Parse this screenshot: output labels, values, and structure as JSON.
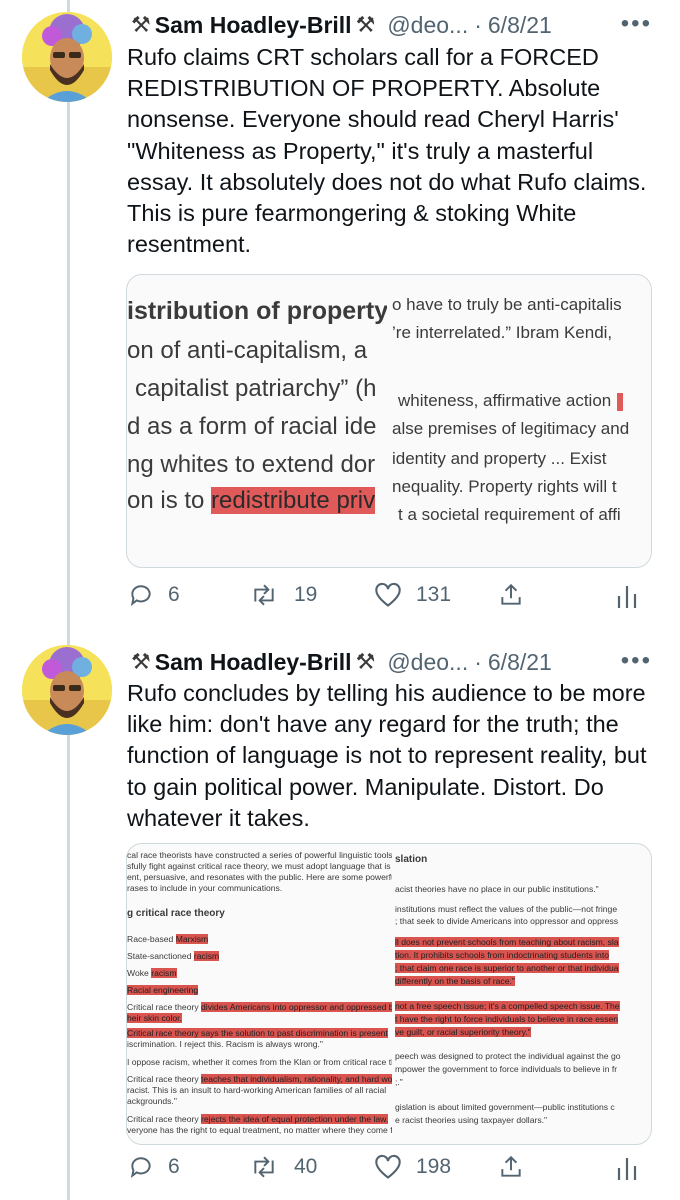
{
  "colors": {
    "thread_line": "#cfd9de",
    "secondary_text": "#536471",
    "highlight": "#e05a5a"
  },
  "tweets": [
    {
      "name": "Sam Hoadley-Brill",
      "emoji": "⚒",
      "handle": "@deo...",
      "dot": "·",
      "date": "6/8/21",
      "more": "•••",
      "text": "Rufo claims CRT scholars call for a FORCED REDISTRIBUTION OF PROPERTY. Absolute nonsense. Everyone should read Cheryl Harris' \"Whiteness as Property,\" it's truly a masterful essay. It absolutely does not do what Rufo claims. This is pure fearmongering & stoking White resentment.",
      "media": {
        "left_lines": [
          "istribution of property",
          "on of anti-capitalism, a",
          "capitalist patriarchy” (h",
          "d as a form of racial ide",
          "ng whites to extend dor",
          "on is to "
        ],
        "left_highlight": "redistribute priv",
        "right_lines": [
          "o have to truly be anti-capitalis",
          "’re interrelated.” Ibram Kendi,",
          "whiteness, affirmative action",
          "alse premises of legitimacy and",
          "identity and property ... Exist",
          "nequality. Property rights will t",
          "t a societal requirement of affi"
        ]
      },
      "actions": {
        "reply_icon": "reply-icon",
        "replies": "6",
        "retweet_icon": "retweet-icon",
        "retweets": "19",
        "like_icon": "like-icon",
        "likes": "131",
        "share_icon": "share-icon",
        "analytics_icon": "analytics-icon"
      }
    },
    {
      "name": "Sam Hoadley-Brill",
      "emoji": "⚒",
      "handle": "@deo...",
      "dot": "·",
      "date": "6/8/21",
      "more": "•••",
      "text": "Rufo concludes by telling his audience to be more like him: don't have any regard for the truth; the function of language is not to represent reality, but to gain political power. Manipulate. Distort. Do whatever it takes.",
      "media": {
        "left_lines": [
          "cal race theorists have constructed a series of powerful linguistic tools.",
          "sfully fight against critical race theory, we must adopt language that is",
          "ent, persuasive, and resonates with the public. Here are some powerful w",
          "rases to include in your communications.",
          "g critical race theory",
          "Race-based",
          "State-sanctioned",
          "Woke",
          "Racial engineering",
          "Critical race theory",
          "heir skin color.",
          "Critical race theory says the solution to past discrimination is present",
          "iscrimination. I reject this. Racism is always wrong.\"",
          "I oppose racism, whether it comes from the Klan or from critical race the",
          "Critical race theory",
          "racist. This is an insult to hard-working American families of all racial",
          "ackgrounds.\"",
          "Critical race theory",
          "veryone has the right to equal treatment, no matter where they come fro"
        ],
        "left_highlights": [
          "Marxism",
          "racism",
          "racism",
          "divides Americans into oppressor and oppressed bas",
          "teaches that individualism, rationality, and hard work",
          "rejects the idea of equal protection under the law."
        ],
        "right_lines": [
          "slation",
          "acist theories have no place in our public institutions.\"",
          "institutions must reflect the values of the public—not fringe",
          "; that seek to divide Americans into oppressor and oppress",
          "ll does not prevent schools from teaching about racism, sla",
          "tion. It prohibits schools from indoctrinating students into",
          "; that claim one race is superior to another or that individua",
          "differently on the basis of race.\"",
          "not a free speech issue; it's a compelled speech issue. The",
          "t have the right to force individuals to believe in race essen",
          "ve guilt, or racial superiority theory.\"",
          "peech was designed to protect the individual against the go",
          "mpower the government to force individuals to believe in fr",
          ";.\"",
          "gislation is about limited government—public institutions c",
          "e racist theories using taxpayer dollars.\""
        ]
      },
      "actions": {
        "reply_icon": "reply-icon",
        "replies": "6",
        "retweet_icon": "retweet-icon",
        "retweets": "40",
        "like_icon": "like-icon",
        "likes": "198",
        "share_icon": "share-icon",
        "analytics_icon": "analytics-icon"
      }
    }
  ]
}
